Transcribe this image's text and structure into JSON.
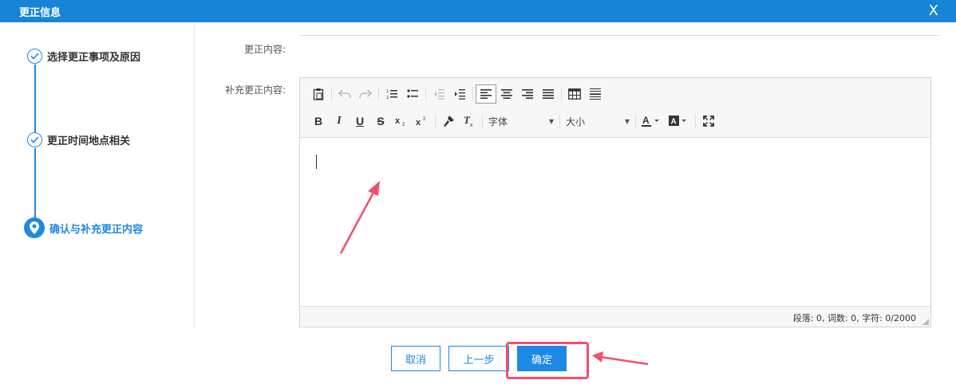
{
  "dialog": {
    "title": "更正信息",
    "close_glyph": "X"
  },
  "steps": [
    {
      "label": "选择更正事项及原因",
      "state": "done"
    },
    {
      "label": "更正时间地点相关",
      "state": "done"
    },
    {
      "label": "确认与补充更正内容",
      "state": "current"
    }
  ],
  "form": {
    "content_label": "更正内容:",
    "supplement_label": "补充更正内容:"
  },
  "editor": {
    "font_select": "字体",
    "size_select": "大小",
    "status": "段落: 0, 词数: 0, 字符: 0/2000",
    "toolbar_icons_row1": [
      "paste-icon",
      "undo-icon",
      "redo-icon",
      "ordered-list-icon",
      "unordered-list-icon",
      "outdent-icon",
      "indent-icon",
      "align-left-icon",
      "align-center-icon",
      "align-right-icon",
      "align-justify-icon",
      "table-icon",
      "horizontal-rule-icon"
    ],
    "toolbar_icons_row2": [
      "bold-icon",
      "italic-icon",
      "underline-icon",
      "strikethrough-icon",
      "subscript-icon",
      "superscript-icon",
      "format-painter-icon",
      "clear-format-icon",
      "font-color-icon",
      "background-color-icon",
      "fullscreen-icon"
    ]
  },
  "buttons": {
    "cancel": "取消",
    "prev": "上一步",
    "confirm": "确定"
  },
  "colors": {
    "header": "#1685d8",
    "accent": "#1e88e5",
    "annotation": "#f0506e"
  }
}
